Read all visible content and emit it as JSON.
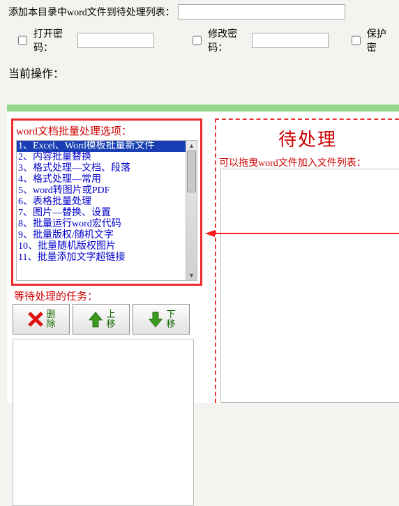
{
  "top": {
    "add_label": "添加本目录中word文件到待处理列表：",
    "add_value": ""
  },
  "pw": {
    "open_label": "打开密码：",
    "open_value": "",
    "modify_label": "修改密码：",
    "modify_value": "",
    "protect_label": "保护密"
  },
  "current_op_label": "当前操作：",
  "left": {
    "title": "word文档批量处理选项：",
    "items": [
      {
        "t": "1、Excel、Word",
        "g": "模板批量新文件",
        "sel": true
      },
      {
        "t": "2、内容批量替换"
      },
      {
        "t": "3、格式处理—文档、段落"
      },
      {
        "t": "4、格式处理—常用"
      },
      {
        "t": "5、word转图片或PDF"
      },
      {
        "t": "6、表格批量处理"
      },
      {
        "t": "7、图片—替换、设置"
      },
      {
        "t": "8、批量运行word宏代码"
      },
      {
        "t": "9、批量版权/随机文字"
      },
      {
        "t": "10、批量随机版权图片"
      },
      {
        "t": "11、批量添加文字超链接"
      }
    ]
  },
  "tasks_label": "等待处理的任务：",
  "buttons": {
    "delete": {
      "l1": "删",
      "l2": "除"
    },
    "up": {
      "l1": "上",
      "l2": "移"
    },
    "down": {
      "l1": "下",
      "l2": "移"
    }
  },
  "right": {
    "title": "待处理",
    "sub": "可以拖曳word文件加入文件列表："
  }
}
